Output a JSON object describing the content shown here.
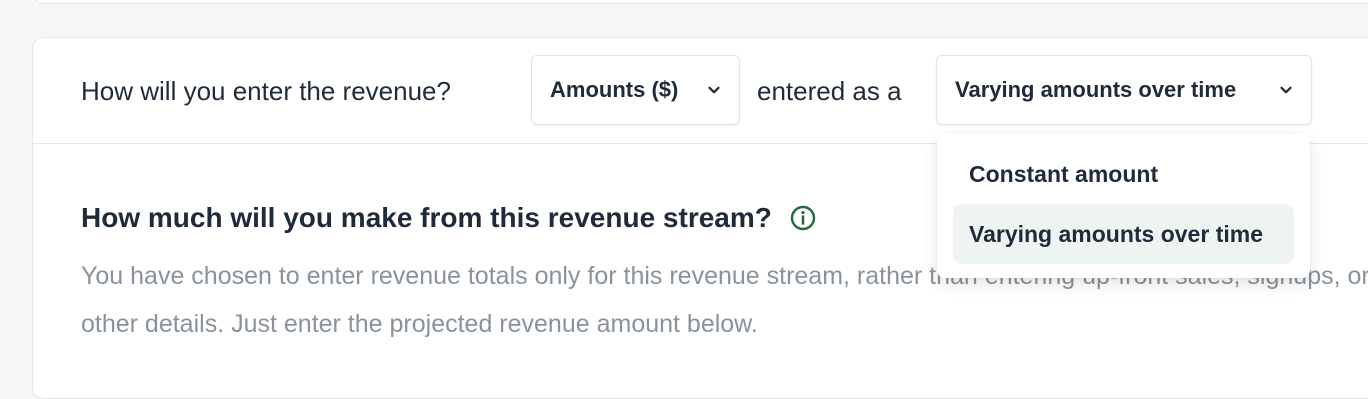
{
  "header": {
    "question_label": "How will you enter the revenue?",
    "entry_type_select": {
      "value": "Amounts ($)"
    },
    "mid_label": "entered as a",
    "amount_mode_select": {
      "value": "Varying amounts over time"
    }
  },
  "dropdown": {
    "options": [
      {
        "label": "Constant amount",
        "selected": false
      },
      {
        "label": "Varying amounts over time",
        "selected": true
      }
    ]
  },
  "section": {
    "title": "How much will you make from this revenue stream?",
    "description": "You have chosen to enter revenue totals only for this revenue stream, rather than entering up-front sales, signups, or other details. Just enter the projected revenue amount below."
  },
  "icons": {
    "info": "info-circle-icon",
    "chevron": "chevron-down-icon"
  },
  "colors": {
    "text": "#1f2b3a",
    "muted_text": "#8a939c",
    "accent_green": "#1d6b3f",
    "selected_bg": "#eef4f2",
    "page_bg": "#f5f7f6"
  }
}
